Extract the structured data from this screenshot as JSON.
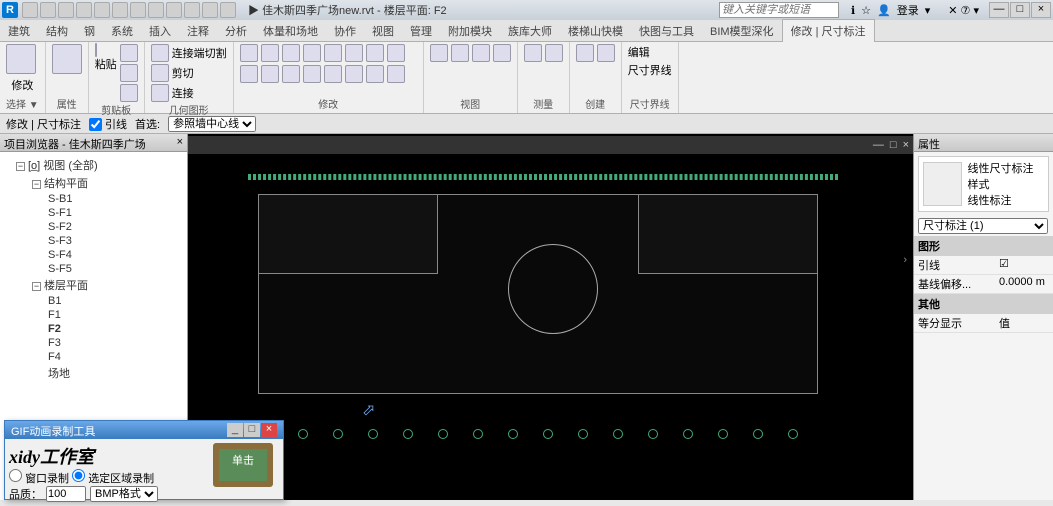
{
  "title": {
    "doc": "佳木斯四季广场new.rvt",
    "view": "楼层平面: F2"
  },
  "search_ph": "键入关键字或短语",
  "user": {
    "login": "登录"
  },
  "menu": [
    "建筑",
    "结构",
    "钢",
    "系统",
    "插入",
    "注释",
    "分析",
    "体量和场地",
    "协作",
    "视图",
    "管理",
    "附加模块",
    "族库大师",
    "楼梯山快模",
    "快图与工具",
    "BIM模型深化"
  ],
  "menu_ctx": "修改 | 尺寸标注",
  "ribbon": {
    "p1": {
      "lbl": "选择 ▼",
      "btn": "修改"
    },
    "p2": {
      "lbl": "属性"
    },
    "p3": {
      "lbl": "剪贴板",
      "btn": "粘贴"
    },
    "p4": {
      "lbl": "几何图形",
      "items": [
        "连接端切割",
        "剪切",
        "连接"
      ]
    },
    "p5": {
      "lbl": "修改"
    },
    "p6": {
      "lbl": "视图"
    },
    "p7": {
      "lbl": "测量"
    },
    "p8": {
      "lbl": "创建"
    },
    "p9": {
      "lbl": "尺寸界线",
      "items": [
        "编辑",
        "尺寸界线",
        "线性标注"
      ]
    }
  },
  "option": {
    "ctx": "修改 | 尺寸标注",
    "chk": "引线",
    "pref": "首选:",
    "sel": "参照墙中心线"
  },
  "browser": {
    "title": "项目浏览器 - 佳木斯四季广场new.rvt",
    "root": "视图 (全部)",
    "g1": "结构平面",
    "g1items": [
      "S-B1",
      "S-F1",
      "S-F2",
      "S-F3",
      "S-F4",
      "S-F5"
    ],
    "g2": "楼层平面",
    "g2items": [
      "B1",
      "F1",
      "F2",
      "F3",
      "F4",
      "场地"
    ]
  },
  "props": {
    "title": "属性",
    "type": "线性尺寸标注样式\n线性标注",
    "sel": "尺寸标注 (1)",
    "s1": "图形",
    "r1": {
      "k": "引线",
      "v": "☑"
    },
    "r2": {
      "k": "基线偏移...",
      "v": "0.0000 m"
    },
    "s2": "其他",
    "r3": {
      "k": "等分显示",
      "v": "值"
    }
  },
  "gif": {
    "title": "GIF动画录制工具",
    "studio": "xidy工作室",
    "opt1": "窗口录制",
    "opt2": "选定区域录制",
    "board": "单击",
    "fmt": "BMP格式",
    "q": "品质：",
    "qv": "100"
  }
}
